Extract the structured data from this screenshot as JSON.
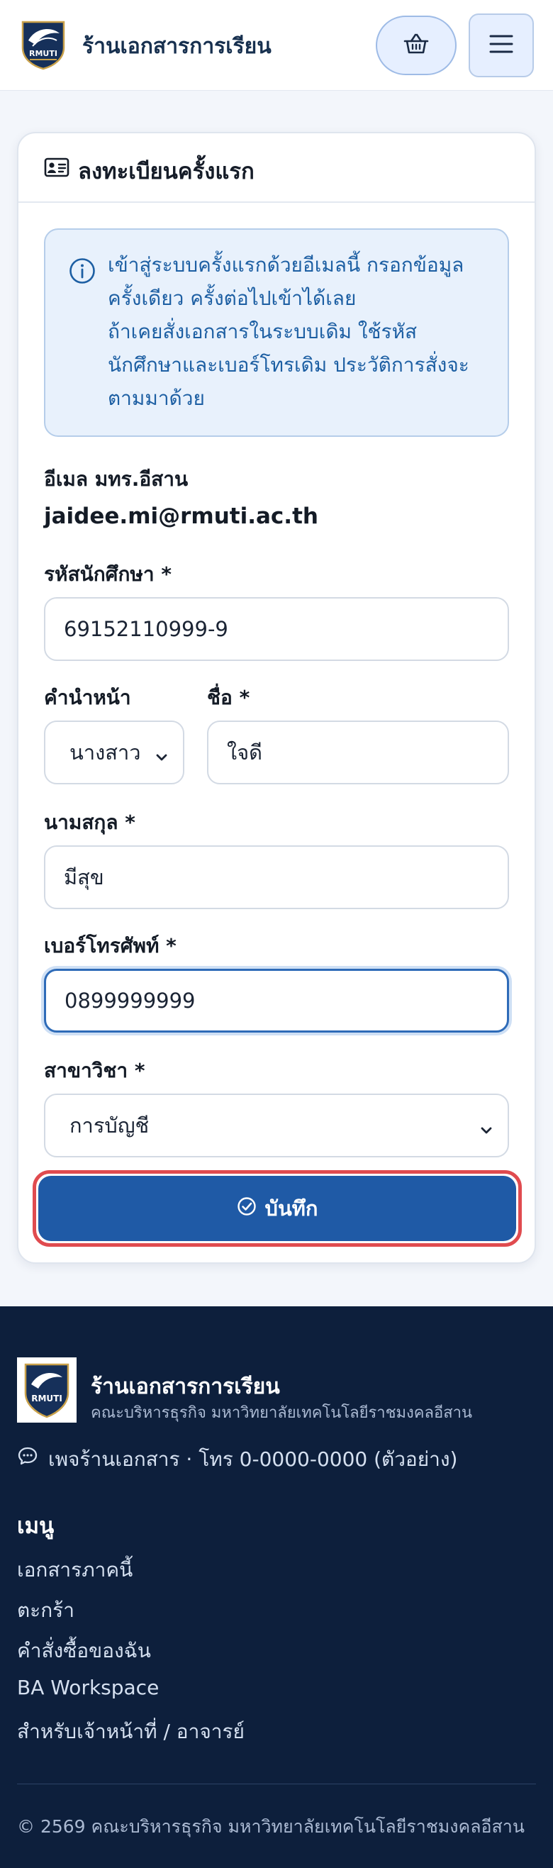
{
  "header": {
    "brand_title": "ร้านเอกสารการเรียน",
    "logo_text": "RMUTI",
    "cart_icon": "basket-icon",
    "menu_icon": "hamburger-menu-icon"
  },
  "register": {
    "title": "ลงทะเบียนครั้งแรก",
    "title_icon": "id-card-icon",
    "alert_icon": "info-circle-icon",
    "alert_lines": [
      "เข้าสู่ระบบครั้งแรกด้วยอีเมลนี้ กรอกข้อมูล",
      "ครั้งเดียว ครั้งต่อไปเข้าได้เลย",
      "ถ้าเคยสั่งเอกสารในระบบเดิม ใช้รหัส",
      "นักศึกษาและเบอร์โทรเดิม ประวัติการสั่งจะ",
      "ตามมาด้วย"
    ],
    "email_label": "อีเมล มทร.อีสาน",
    "email_value": "jaidee.mi@rmuti.ac.th",
    "student_id_label": "รหัสนักศึกษา *",
    "student_id_value": "69152110999-9",
    "prefix_label": "คำนำหน้า",
    "prefix_value": "นางสาว",
    "first_name_label": "ชื่อ *",
    "first_name_value": "ใจดี",
    "last_name_label": "นามสกุล *",
    "last_name_value": "มีสุข",
    "phone_label": "เบอร์โทรศัพท์ *",
    "phone_value": "0899999999",
    "major_label": "สาขาวิชา *",
    "major_value": "การบัญชี",
    "save_label": "บันทึก",
    "save_icon": "check-circle-icon"
  },
  "footer": {
    "title": "ร้านเอกสารการเรียน",
    "subtitle": "คณะบริหารธุรกิจ มหาวิทยาลัยเทคโนโลยีราชมงคลอีสาน",
    "contact_icon": "chat-bubble-icon",
    "contact": "เพจร้านเอกสาร · โทร 0-0000-0000 (ตัวอย่าง)",
    "menu_title": "เมนู",
    "links": [
      "เอกสารภาคนี้",
      "ตะกร้า",
      "คำสั่งซื้อของฉัน",
      "BA Workspace",
      "สำหรับเจ้าหน้าที่ / อาจารย์"
    ],
    "copyright": "© 2569 คณะบริหารธุรกิจ มหาวิทยาลัยเทคโนโลยีราชมงคลอีสาน"
  },
  "colors": {
    "brand_navy": "#17304f",
    "primary": "#1f5aa6",
    "alert_bg": "#e8f1fc",
    "alert_text": "#1d5fa3",
    "footer_bg": "#0d1f3c",
    "highlight_outline": "#e04b4f"
  }
}
